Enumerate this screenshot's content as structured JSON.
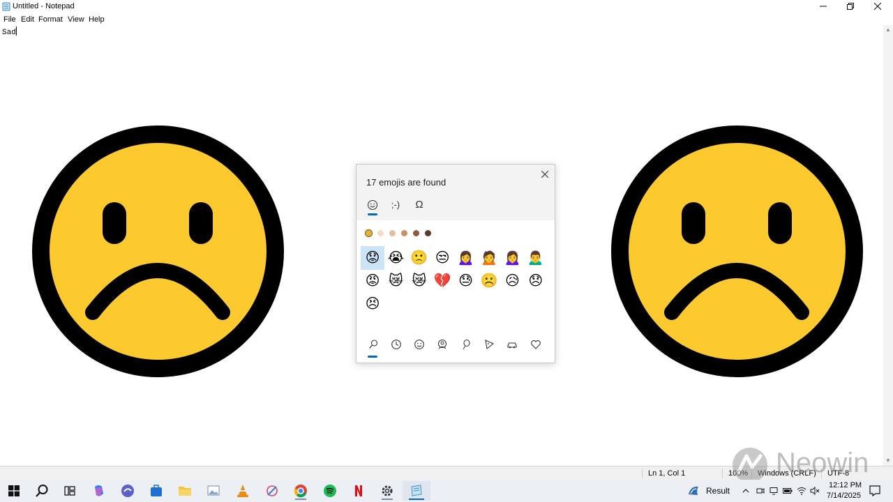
{
  "window": {
    "title": "Untitled - Notepad",
    "minimize": "minimize",
    "maximize": "restore",
    "close": "close"
  },
  "menu": {
    "file": "File",
    "edit": "Edit",
    "format": "Format",
    "view": "View",
    "help": "Help"
  },
  "editor": {
    "text": "Sad"
  },
  "status": {
    "position": "Ln 1, Col 1",
    "zoom": "100%",
    "line_ending": "Windows (CRLF)",
    "encoding": "UTF-8"
  },
  "emoji_panel": {
    "found_text": "17 emojis are found",
    "tabs": [
      {
        "name": "emoji",
        "icon": "smiley-icon"
      },
      {
        "name": "kaomoji",
        "label": ";-)"
      },
      {
        "name": "symbols",
        "label": "Ω"
      }
    ],
    "skin_tones": [
      "#e4b43a",
      "#f6dcc6",
      "#e6bd9a",
      "#c49168",
      "#8d5a3c",
      "#5a3a28"
    ],
    "emojis": [
      "😟",
      "😭",
      "🙁",
      "😒",
      "🙍‍♀️",
      "🙍",
      "🙍‍♀️",
      "🙍‍♂️",
      "😡",
      "😿",
      "😿",
      "💔",
      "😓",
      "☹️",
      "😥",
      "😞",
      "😣"
    ],
    "categories": [
      "search-icon",
      "clock-icon",
      "smiley-icon",
      "person-icon",
      "balloon-icon",
      "pizza-icon",
      "car-icon",
      "heart-icon"
    ]
  },
  "taskbar": {
    "apps": [
      "windows-start-icon",
      "search-icon",
      "task-view-icon",
      "copilot-icon",
      "browser-icon",
      "store-icon",
      "file-explorer-icon",
      "photos-icon",
      "vlc-icon",
      "paint-icon",
      "chrome-icon",
      "spotify-icon",
      "netflix-icon",
      "settings-icon",
      "notepad-icon"
    ],
    "weather_label": "Result",
    "time": "12:12 PM",
    "date": "7/14/2025"
  },
  "watermark": {
    "text": "Neowin"
  },
  "colors": {
    "face_yellow": "#fcca2e",
    "face_outline": "#000000",
    "accent": "#0067c0",
    "selected_bg": "#cce4f7"
  }
}
